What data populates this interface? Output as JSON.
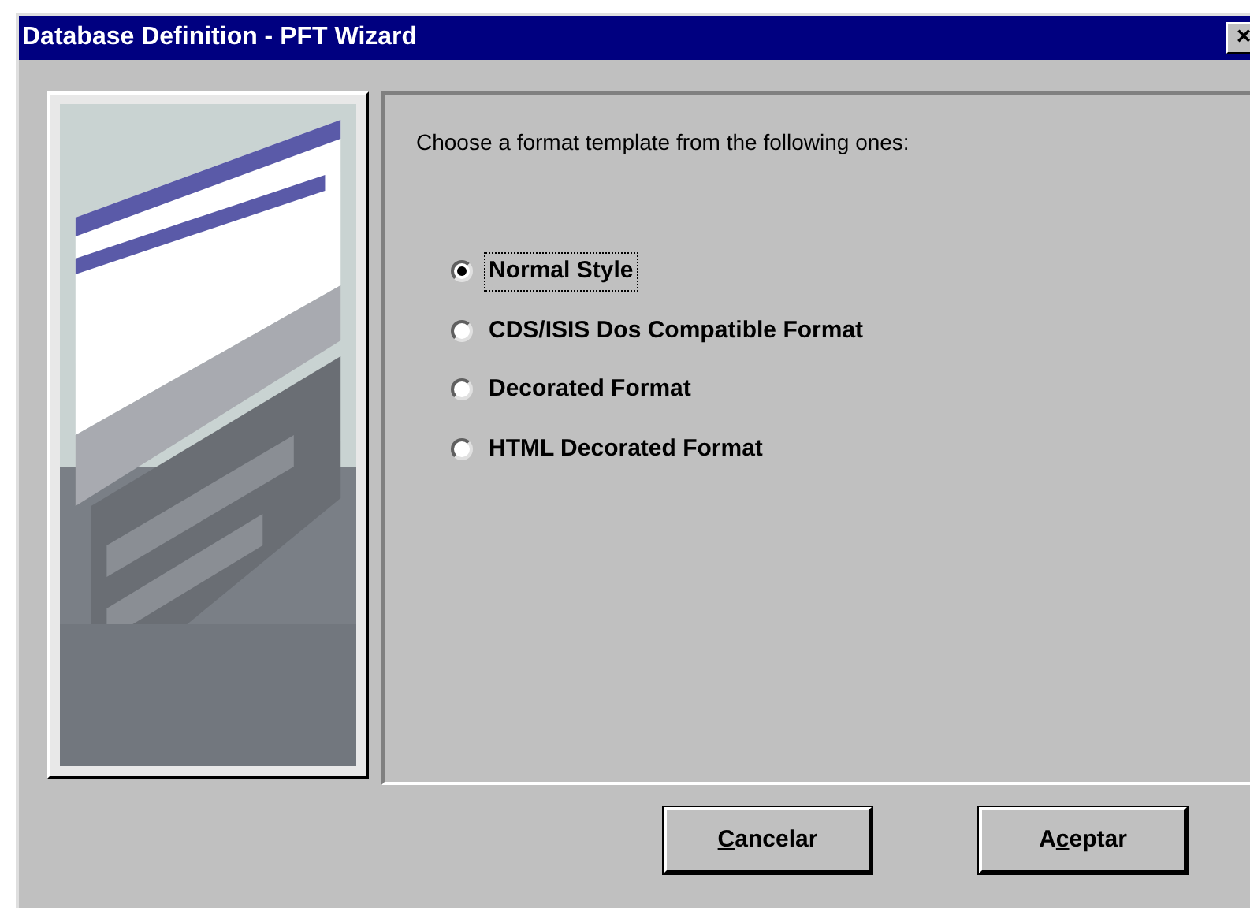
{
  "window": {
    "title": "Database Definition - PFT Wizard",
    "close": "×"
  },
  "prompt": "Choose a format template from the following ones:",
  "options": [
    {
      "label": "Normal Style",
      "selected": true
    },
    {
      "label": "CDS/ISIS Dos Compatible Format",
      "selected": false
    },
    {
      "label": "Decorated Format",
      "selected": false
    },
    {
      "label": "HTML Decorated Format",
      "selected": false
    }
  ],
  "buttons": [
    {
      "label_parts": [
        {
          "text": "C",
          "underlined": true
        },
        {
          "text": "ancelar",
          "underlined": false
        }
      ]
    },
    {
      "label_parts": [
        {
          "text": "A",
          "underlined": false
        },
        {
          "text": "c",
          "underlined": true
        },
        {
          "text": "eptar",
          "underlined": false
        }
      ]
    }
  ]
}
